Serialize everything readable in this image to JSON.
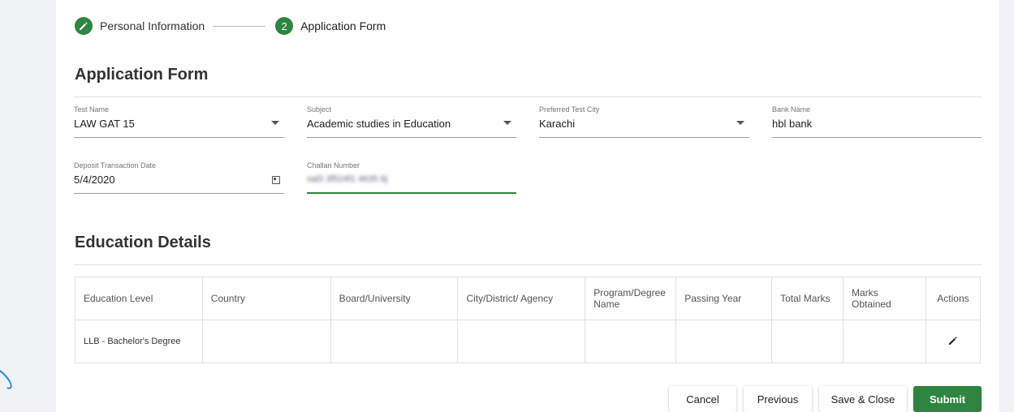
{
  "stepper": {
    "step1_label": "Personal Information",
    "step2_number": "2",
    "step2_label": "Application Form"
  },
  "form": {
    "title": "Application Form",
    "fields": [
      {
        "label": "Test Name",
        "value": "LAW GAT 15",
        "type": "select"
      },
      {
        "label": "Subject",
        "value": "Academic studies in Education",
        "type": "select"
      },
      {
        "label": "Preferred Test City",
        "value": "Karachi",
        "type": "select"
      },
      {
        "label": "Bank Name",
        "value": "hbl bank",
        "type": "text"
      },
      {
        "label": "Deposit Transaction Date",
        "value": "5/4/2020",
        "type": "date"
      },
      {
        "label": "Challan Number",
        "value": "sal3 3f524f1 4635 6j",
        "type": "text"
      }
    ]
  },
  "education": {
    "title": "Education Details",
    "columns": [
      "Education Level",
      "Country",
      "Board/University",
      "City/District/ Agency",
      "Program/Degree Name",
      "Passing Year",
      "Total Marks",
      "Marks Obtained",
      "Actions"
    ],
    "rows": [
      [
        "LLB - Bachelor's Degree",
        "",
        "",
        "",
        "",
        "",
        "",
        "",
        ""
      ]
    ]
  },
  "buttons": {
    "cancel": "Cancel",
    "previous": "Previous",
    "save_close": "Save & Close",
    "submit": "Submit"
  },
  "colors": {
    "accent": "#2e8540",
    "background": "#f1f2f5"
  },
  "icons": {
    "step1": "pencil-icon",
    "date": "calendar-icon",
    "dropdown": "caret-down-icon",
    "row_action": "edit-icon"
  }
}
